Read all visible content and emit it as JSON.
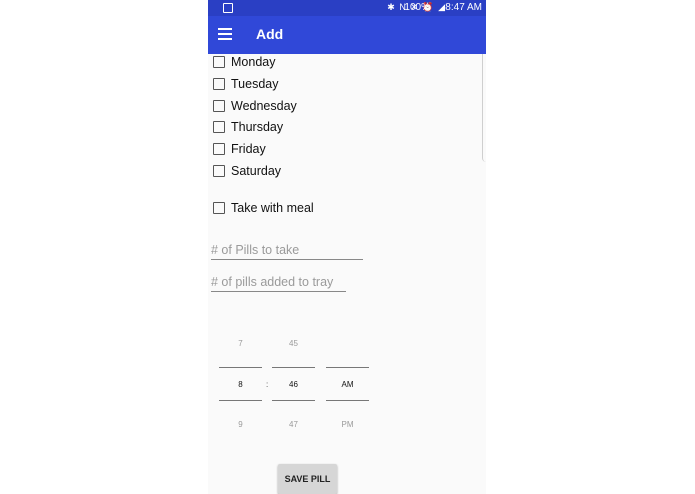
{
  "status_bar": {
    "indicators": "✱ N ✕ ⏰ ◢",
    "battery": "100%",
    "time": "8:47 AM"
  },
  "app_bar": {
    "title": "Add"
  },
  "days": [
    {
      "label": "Monday",
      "checked": false
    },
    {
      "label": "Tuesday",
      "checked": false
    },
    {
      "label": "Wednesday",
      "checked": false
    },
    {
      "label": "Thursday",
      "checked": false
    },
    {
      "label": "Friday",
      "checked": false
    },
    {
      "label": "Saturday",
      "checked": false
    }
  ],
  "meal": {
    "label": "Take with meal",
    "checked": false
  },
  "fields": {
    "pills_to_take": {
      "placeholder": "# of Pills to take",
      "value": ""
    },
    "pills_added": {
      "placeholder": "# of pills added to tray",
      "value": ""
    }
  },
  "time_picker": {
    "hour": {
      "prev": "7",
      "value": "8",
      "next": "9"
    },
    "separator": ":",
    "minute": {
      "prev": "45",
      "value": "46",
      "next": "47"
    },
    "ampm": {
      "prev": "",
      "value": "AM",
      "next": "PM"
    }
  },
  "save_button": {
    "label": "SAVE PILL"
  },
  "colors": {
    "app_bar": "#3048d8",
    "status_bar": "#2a3fc4",
    "background": "#fafafa"
  }
}
